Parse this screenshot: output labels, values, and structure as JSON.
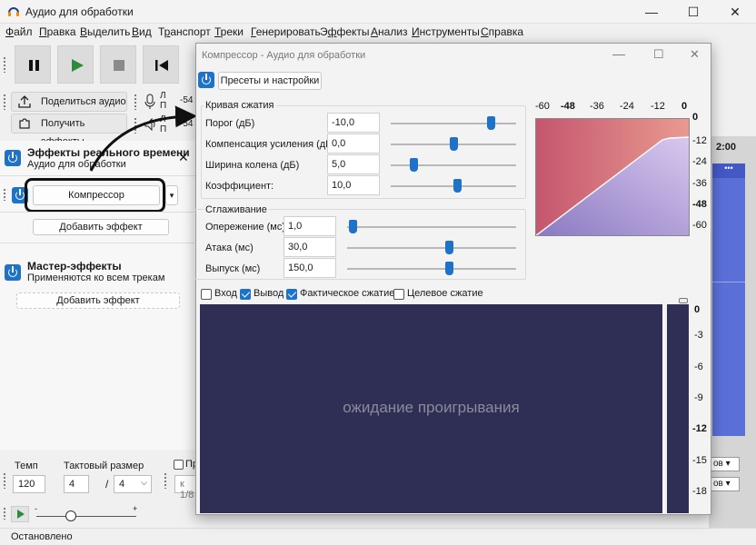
{
  "window": {
    "title": "Аудио для обработки",
    "minimize": "—",
    "maximize": "☐",
    "close": "✕"
  },
  "menu": [
    {
      "pre": "",
      "u": "Ф",
      "post": "айл"
    },
    {
      "pre": "",
      "u": "П",
      "post": "равка"
    },
    {
      "pre": "",
      "u": "В",
      "post": "ыделить"
    },
    {
      "pre": "",
      "u": "В",
      "post": "ид"
    },
    {
      "pre": "Т",
      "u": "р",
      "post": "анспорт"
    },
    {
      "pre": "",
      "u": "Т",
      "post": "реки"
    },
    {
      "pre": "",
      "u": "Г",
      "post": "енерировать"
    },
    {
      "pre": "Э",
      "u": "ф",
      "post": "фекты"
    },
    {
      "pre": "",
      "u": "А",
      "post": "нализ"
    },
    {
      "pre": "",
      "u": "И",
      "post": "нструменты"
    },
    {
      "pre": "",
      "u": "С",
      "post": "правка"
    }
  ],
  "toolbar": {
    "share_label": "Поделиться аудио",
    "get_effects_label": "Получить эффекты",
    "meter_top": "Л",
    "meter_bottom": "П",
    "meter_value_top": "-54",
    "meter_value_bottom": "-54"
  },
  "realtime": {
    "title": "Эффекты реального времени",
    "subtitle": "Аудио для обработки",
    "effect_name": "Компрессор",
    "add_effect": "Добавить эффект"
  },
  "master": {
    "title": "Мастер-эффекты",
    "subtitle": "Применяются ко всем трекам",
    "add_effect": "Добавить эффект"
  },
  "bottom": {
    "tempo_label": "Темп",
    "tempo_value": "120",
    "meter_label": "Тактовый размер",
    "meter_num": "4",
    "meter_sep": "/",
    "meter_den": "4",
    "snap_label": "Пр",
    "snap_value": "к 1/8",
    "rate_min": "-",
    "rate_max": "+"
  },
  "status": {
    "text": "Остановлено"
  },
  "track": {
    "time_label": "2:00",
    "menu_dots": "•••",
    "db_suffix": "ов"
  },
  "dialog": {
    "title": "Компрессор - Аудио для обработки",
    "presets_button": "Пресеты и настройки",
    "curve_group": "Кривая сжатия",
    "smoothing_group": "Сглаживание",
    "params": [
      {
        "label": "Порог (дБ)",
        "value": "-10,0",
        "fraction": 0.8
      },
      {
        "label": "Компенсация усиления (дБ)",
        "value": "0,0",
        "fraction": 0.5
      },
      {
        "label": "Ширина колена (дБ)",
        "value": "5,0",
        "fraction": 0.18
      },
      {
        "label": "Коэффициент:",
        "value": "10,0",
        "fraction": 0.53
      }
    ],
    "smoothing": [
      {
        "label": "Опережение (мс)",
        "value": "1,0",
        "fraction": 0.03
      },
      {
        "label": "Атака (мс)",
        "value": "30,0",
        "fraction": 0.6
      },
      {
        "label": "Выпуск (мс)",
        "value": "150,0",
        "fraction": 0.6
      }
    ],
    "graph_top_labels": [
      "-60",
      "-48",
      "-36",
      "-24",
      "-12",
      "0"
    ],
    "graph_top_bold": [
      false,
      true,
      false,
      false,
      false,
      true
    ],
    "graph_right_labels": [
      "0",
      "-12",
      "-24",
      "-36",
      "-48",
      "-60"
    ],
    "graph_right_bold": [
      true,
      false,
      false,
      false,
      true,
      false
    ],
    "checkboxes": [
      {
        "label": "Вход",
        "checked": false
      },
      {
        "label": "Вывод",
        "checked": true
      },
      {
        "label": "Фактическое сжатие",
        "checked": true
      },
      {
        "label": "Целевое сжатие",
        "checked": false
      }
    ],
    "waiting_text": "ожидание проигрывания",
    "meter_labels": [
      "0",
      "-3",
      "-6",
      "-9",
      "-12",
      "-15",
      "-18"
    ],
    "meter_bold": [
      true,
      false,
      false,
      false,
      true,
      false,
      false
    ]
  },
  "colors": {
    "accent": "#1e73c8",
    "plot_bg": "#2f2f56",
    "curve_top": "#d98080",
    "curve_bottom": "#b7a6d9"
  }
}
